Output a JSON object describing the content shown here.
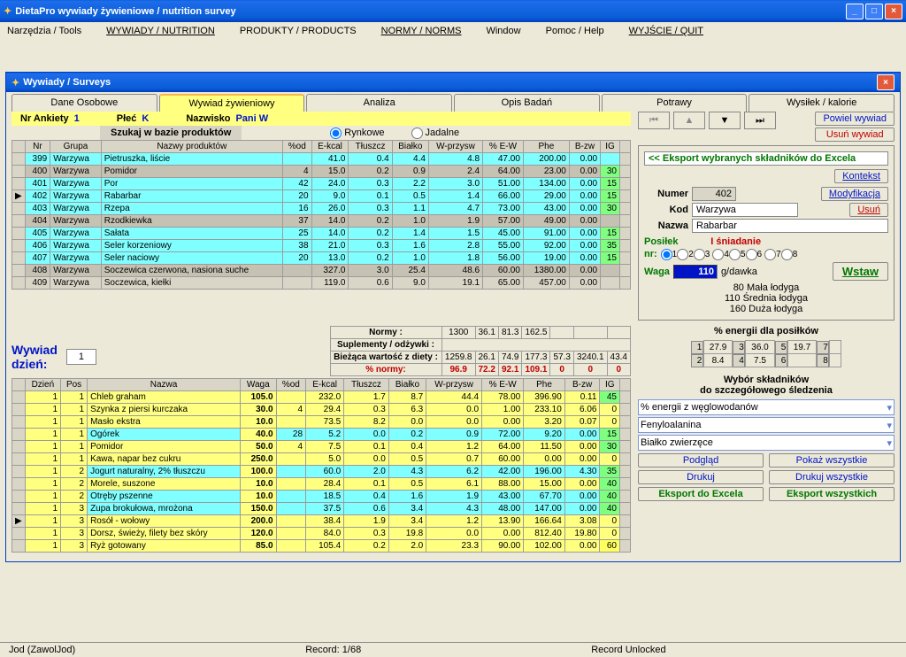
{
  "app": {
    "title": "DietaPro    wywiady żywieniowe / nutrition survey"
  },
  "menu": [
    "Narzędzia / Tools",
    "WYWIADY / NUTRITION",
    "PRODUKTY / PRODUCTS",
    "NORMY / NORMS",
    "Window",
    "Pomoc / Help",
    "WYJŚCIE / QUIT"
  ],
  "inner": {
    "title": "Wywiady / Surveys"
  },
  "tabs": [
    "Dane Osobowe",
    "Wywiad żywieniowy",
    "Analiza",
    "Opis Badań",
    "Potrawy",
    "Wysiłek / kalorie"
  ],
  "activeTab": 1,
  "header": {
    "nrAnkietyLabel": "Nr Ankiety",
    "nrAnkiety": "1",
    "plecLabel": "Płeć",
    "plec": "K",
    "nazwiskoLabel": "Nazwisko",
    "nazwisko": "Pani W"
  },
  "search": {
    "label": "Szukaj w bazie produktów",
    "r1": "Rynkowe",
    "r2": "Jadalne"
  },
  "productCols": [
    "Nr",
    "Grupa",
    "Nazwy produktów",
    "%od",
    "E-kcal",
    "Tłuszcz",
    "Białko",
    "W-przysw",
    "% E-W",
    "Phe",
    "B-zw",
    "IG"
  ],
  "products": [
    {
      "nr": 399,
      "grp": "Warzywa",
      "name": "Pietruszka, liście",
      "od": "",
      "e": 41.0,
      "t": 0.4,
      "b": 4.4,
      "w": 4.8,
      "ew": 47.0,
      "phe": 200.0,
      "bz": 0.0,
      "ig": "",
      "cyan": true
    },
    {
      "nr": 400,
      "grp": "Warzywa",
      "name": "Pomidor",
      "od": 4,
      "e": 15.0,
      "t": 0.2,
      "b": 0.9,
      "w": 2.4,
      "ew": 64.0,
      "phe": 23.0,
      "bz": 0.0,
      "ig": 30
    },
    {
      "nr": 401,
      "grp": "Warzywa",
      "name": "Por",
      "od": 42,
      "e": 24.0,
      "t": 0.3,
      "b": 2.2,
      "w": 3.0,
      "ew": 51.0,
      "phe": 134.0,
      "bz": 0.0,
      "ig": 15,
      "cyan": true
    },
    {
      "nr": 402,
      "grp": "Warzywa",
      "name": "Rabarbar",
      "od": 20,
      "e": 9.0,
      "t": 0.1,
      "b": 0.5,
      "w": 1.4,
      "ew": 66.0,
      "phe": 29.0,
      "bz": 0.0,
      "ig": 15,
      "cyan": true,
      "sel": true
    },
    {
      "nr": 403,
      "grp": "Warzywa",
      "name": "Rzepa",
      "od": 16,
      "e": 26.0,
      "t": 0.3,
      "b": 1.1,
      "w": 4.7,
      "ew": 73.0,
      "phe": 43.0,
      "bz": 0.0,
      "ig": 30,
      "cyan": true
    },
    {
      "nr": 404,
      "grp": "Warzywa",
      "name": "Rzodkiewka",
      "od": 37,
      "e": 14.0,
      "t": 0.2,
      "b": 1.0,
      "w": 1.9,
      "ew": 57.0,
      "phe": 49.0,
      "bz": 0.0,
      "ig": ""
    },
    {
      "nr": 405,
      "grp": "Warzywa",
      "name": "Sałata",
      "od": 25,
      "e": 14.0,
      "t": 0.2,
      "b": 1.4,
      "w": 1.5,
      "ew": 45.0,
      "phe": 91.0,
      "bz": 0.0,
      "ig": 15,
      "cyan": true
    },
    {
      "nr": 406,
      "grp": "Warzywa",
      "name": "Seler korzeniowy",
      "od": 38,
      "e": 21.0,
      "t": 0.3,
      "b": 1.6,
      "w": 2.8,
      "ew": 55.0,
      "phe": 92.0,
      "bz": 0.0,
      "ig": 35,
      "cyan": true
    },
    {
      "nr": 407,
      "grp": "Warzywa",
      "name": "Seler naciowy",
      "od": 20,
      "e": 13.0,
      "t": 0.2,
      "b": 1.0,
      "w": 1.8,
      "ew": 56.0,
      "phe": 19.0,
      "bz": 0.0,
      "ig": 15,
      "cyan": true
    },
    {
      "nr": 408,
      "grp": "Warzywa",
      "name": "Soczewica czerwona, nasiona suche",
      "od": "",
      "e": 327.0,
      "t": 3.0,
      "b": 25.4,
      "w": 48.6,
      "ew": 60.0,
      "phe": 1380.0,
      "bz": 0.0,
      "ig": ""
    },
    {
      "nr": 409,
      "grp": "Warzywa",
      "name": "Soczewica, kiełki",
      "od": "",
      "e": 119.0,
      "t": 0.6,
      "b": 9.0,
      "w": 19.1,
      "ew": 65.0,
      "phe": 457.0,
      "bz": 0.0,
      "ig": ""
    }
  ],
  "rightBtns": {
    "powiel": "Powiel wywiad",
    "usun": "Usuń wywiad"
  },
  "export": {
    "header": "<< Eksport wybranych składników do Excela",
    "kontekst": "Kontekst",
    "modyf": "Modyfikacja",
    "usun": "Usuń"
  },
  "detail": {
    "numerL": "Numer",
    "numer": "402",
    "kodL": "Kod",
    "kod": "Warzywa",
    "nazwaL": "Nazwa",
    "nazwa": "Rabarbar",
    "posilekL": "Posiłek",
    "sniad": "I śniadanie",
    "nrL": "nr:",
    "wagaL": "Waga",
    "waga": "110",
    "gdawka": "g/dawka",
    "wstaw": "Wstaw",
    "hints": [
      "80 Mała łodyga",
      "110 Średnia łodyga",
      "160 Duża łodyga"
    ]
  },
  "normy": {
    "labels": [
      "Normy :",
      "Suplementy / odżywki :",
      "Bieżąca wartość z diety :",
      "% normy:"
    ],
    "row1": [
      1300,
      36.1,
      81.3,
      162.5,
      "",
      "",
      ""
    ],
    "row2": [
      "",
      "",
      "",
      "",
      "",
      "",
      ""
    ],
    "row3": [
      1259.8,
      26.1,
      74.9,
      177.3,
      57.3,
      3240.1,
      43.4
    ],
    "row4": [
      96.9,
      72.2,
      92.1,
      109.1,
      0.0,
      0.0,
      0.0
    ]
  },
  "dzien": {
    "l1": "Wywiad",
    "l2": "dzień:",
    "val": "1"
  },
  "mealCols": [
    "Dzień",
    "Pos",
    "Nazwa",
    "Waga",
    "%od",
    "E-kcal",
    "Tłuszcz",
    "Białko",
    "W-przysw",
    "% E-W",
    "Phe",
    "B-zw",
    "IG"
  ],
  "meals": [
    {
      "d": 1,
      "p": 1,
      "name": "Chleb graham",
      "w": "105.0",
      "od": "",
      "e": 232.0,
      "t": 1.7,
      "b": 8.7,
      "wp": 44.4,
      "ew": 78.0,
      "phe": 396.9,
      "bz": 0.11,
      "ig": 45,
      "igc": "g"
    },
    {
      "d": 1,
      "p": 1,
      "name": "Szynka z piersi kurczaka",
      "w": "30.0",
      "od": 4,
      "e": 29.4,
      "t": 0.3,
      "b": 6.3,
      "wp": 0.0,
      "ew": 1.0,
      "phe": 233.1,
      "bz": 6.06,
      "ig": 0
    },
    {
      "d": 1,
      "p": 1,
      "name": "Masło ekstra",
      "w": "10.0",
      "od": "",
      "e": 73.5,
      "t": 8.2,
      "b": 0.0,
      "wp": 0.0,
      "ew": 0.0,
      "phe": 3.2,
      "bz": 0.07,
      "ig": 0
    },
    {
      "d": 1,
      "p": 1,
      "name": "Ogórek",
      "w": "40.0",
      "od": 28,
      "e": 5.2,
      "t": 0.0,
      "b": 0.2,
      "wp": 0.9,
      "ew": 72.0,
      "phe": 9.2,
      "bz": 0.0,
      "ig": 15,
      "igc": "g",
      "cyan": true
    },
    {
      "d": 1,
      "p": 1,
      "name": "Pomidor",
      "w": "50.0",
      "od": 4,
      "e": 7.5,
      "t": 0.1,
      "b": 0.4,
      "wp": 1.2,
      "ew": 64.0,
      "phe": 11.5,
      "bz": 0.0,
      "ig": 30,
      "igc": "g"
    },
    {
      "d": 1,
      "p": 1,
      "name": "Kawa, napar bez cukru",
      "w": "250.0",
      "od": "",
      "e": 5.0,
      "t": 0.0,
      "b": 0.5,
      "wp": 0.7,
      "ew": 60.0,
      "phe": 0.0,
      "bz": 0.0,
      "ig": 0
    },
    {
      "d": 1,
      "p": 2,
      "name": "Jogurt naturalny, 2% tłuszczu",
      "w": "100.0",
      "od": "",
      "e": 60.0,
      "t": 2.0,
      "b": 4.3,
      "wp": 6.2,
      "ew": 42.0,
      "phe": 196.0,
      "bz": 4.3,
      "ig": 35,
      "igc": "g",
      "cyan": true
    },
    {
      "d": 1,
      "p": 2,
      "name": "Morele, suszone",
      "w": "10.0",
      "od": "",
      "e": 28.4,
      "t": 0.1,
      "b": 0.5,
      "wp": 6.1,
      "ew": 88.0,
      "phe": 15.0,
      "bz": 0.0,
      "ig": 40,
      "igc": "g"
    },
    {
      "d": 1,
      "p": 2,
      "name": "Otręby pszenne",
      "w": "10.0",
      "od": "",
      "e": 18.5,
      "t": 0.4,
      "b": 1.6,
      "wp": 1.9,
      "ew": 43.0,
      "phe": 67.7,
      "bz": 0.0,
      "ig": 40,
      "igc": "g",
      "cyan": true
    },
    {
      "d": 1,
      "p": 3,
      "name": "Zupa brokułowa, mrożona",
      "w": "150.0",
      "od": "",
      "e": 37.5,
      "t": 0.6,
      "b": 3.4,
      "wp": 4.3,
      "ew": 48.0,
      "phe": 147.0,
      "bz": 0.0,
      "ig": 40,
      "igc": "g",
      "cyan": true
    },
    {
      "d": 1,
      "p": 3,
      "name": "Rosół - wołowy",
      "w": "200.0",
      "od": "",
      "e": 38.4,
      "t": 1.9,
      "b": 3.4,
      "wp": 1.2,
      "ew": 13.9,
      "phe": 166.64,
      "bz": 3.08,
      "ig": 0,
      "sel": true
    },
    {
      "d": 1,
      "p": 3,
      "name": "Dorsz, świeży, filety bez skóry",
      "w": "120.0",
      "od": "",
      "e": 84.0,
      "t": 0.3,
      "b": 19.8,
      "wp": 0.0,
      "ew": 0.0,
      "phe": 812.4,
      "bz": 19.8,
      "ig": 0
    },
    {
      "d": 1,
      "p": 3,
      "name": "Ryż gotowany",
      "w": "85.0",
      "od": "",
      "e": 105.4,
      "t": 0.2,
      "b": 2.0,
      "wp": 23.3,
      "ew": 90.0,
      "phe": 102.0,
      "bz": 0.0,
      "ig": 60,
      "igc": "y"
    }
  ],
  "energy": {
    "title": "% energii dla posiłków",
    "cells": [
      [
        "1",
        "27.9"
      ],
      [
        "3",
        "36.0"
      ],
      [
        "5",
        "19.7"
      ],
      [
        "7",
        ""
      ],
      [
        "2",
        "8.4"
      ],
      [
        "4",
        "7.5"
      ],
      [
        "6",
        ""
      ],
      [
        "8",
        ""
      ]
    ]
  },
  "track": {
    "title1": "Wybór składników",
    "title2": "do szczegółowego śledzenia",
    "sel1": "% energii z węglowodanów",
    "sel2": "Fenyloalanina",
    "sel3": "Białko zwierzęce"
  },
  "btns": {
    "podglad": "Podgląd",
    "pokaz": "Pokaż wszystkie",
    "drukuj": "Drukuj",
    "drukujw": "Drukuj wszystkie",
    "eksport": "Eksport do Excela",
    "eksportw": "Eksport wszystkich"
  },
  "status": {
    "l": "Jod (ZawolJod)",
    "c": "Record: 1/68",
    "r": "Record Unlocked"
  }
}
